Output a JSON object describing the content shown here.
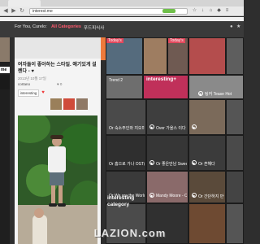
{
  "browser": {
    "url": "interest.me",
    "tab_label": ""
  },
  "nav": {
    "greeting": "For You, Curelo:",
    "all_categories": "All Categories",
    "tab_icon_label": "푸드피식사",
    "notification_icon": "bell-icon",
    "star_icon": "star-icon"
  },
  "left": {
    "label": "me"
  },
  "card": {
    "title": "여자들이 좋아하는 스타일. 얘기있게 설렌다 - ♥",
    "meta": "2013년 10월 17일",
    "user": "cortano",
    "stats": "♥ 0",
    "tag": "interesting",
    "heart": "♥"
  },
  "right": {
    "badges": [
      "Today's",
      "Today's"
    ],
    "interesting_label": "interesting+",
    "trend_label": "Trend 2",
    "titles": {
      "t_tease": "팅커 Tease Hot",
      "t_row3a": "Or 숙소주인와 지오미가 본문",
      "t_row3b": "Over 가을스 이다",
      "t_row4a": "Or 홈으로 가나 OST(Pumpkin)",
      "t_row4b": "Or 좋은만남 Sweet Dream",
      "t_row4c": "Or 흔해다",
      "t_row5a": "Or We are the World",
      "t_row5b": "Mandy Moore - Only Hope",
      "t_row5c": "Or 간단하지 만들기"
    },
    "category_label": "interesting category"
  },
  "watermark": "LAZION.com",
  "colors": {
    "accent_red": "#ff5a6e",
    "orange": "#ee7a3c",
    "tile_red": "#e2485c"
  }
}
